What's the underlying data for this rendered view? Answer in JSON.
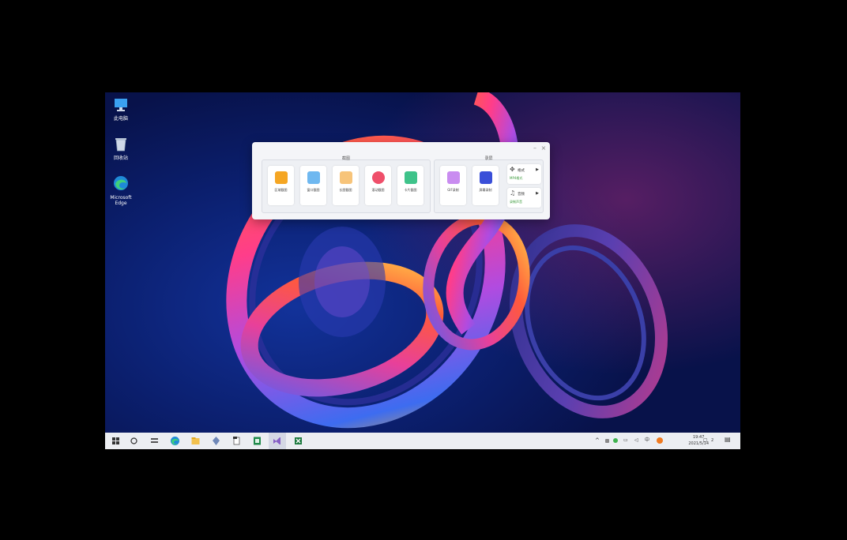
{
  "desktop": {
    "icons": [
      {
        "label": "此电脑"
      },
      {
        "label": "回收站"
      },
      {
        "label": "Microsoft Edge"
      }
    ]
  },
  "dialog": {
    "group1_label": "截图",
    "group2_label": "录屏",
    "tools": [
      {
        "label": "区域截图"
      },
      {
        "label": "窗口截图"
      },
      {
        "label": "长图截图"
      },
      {
        "label": "滚动截图"
      },
      {
        "label": "卡片截图"
      }
    ],
    "record_tools": [
      {
        "label": "GIF录制"
      },
      {
        "label": "屏幕录制"
      }
    ],
    "side_options": [
      {
        "title": "格式",
        "sub": "MP4格式"
      },
      {
        "title": "音频",
        "sub": "录制声音"
      }
    ]
  },
  "taskbar": {
    "clock_time": "19:47",
    "clock_date": "2021/5/14",
    "notification_count": "2"
  },
  "colors": {
    "accent": "#4a7bd8",
    "taskbar_bg": "#eceef2"
  }
}
